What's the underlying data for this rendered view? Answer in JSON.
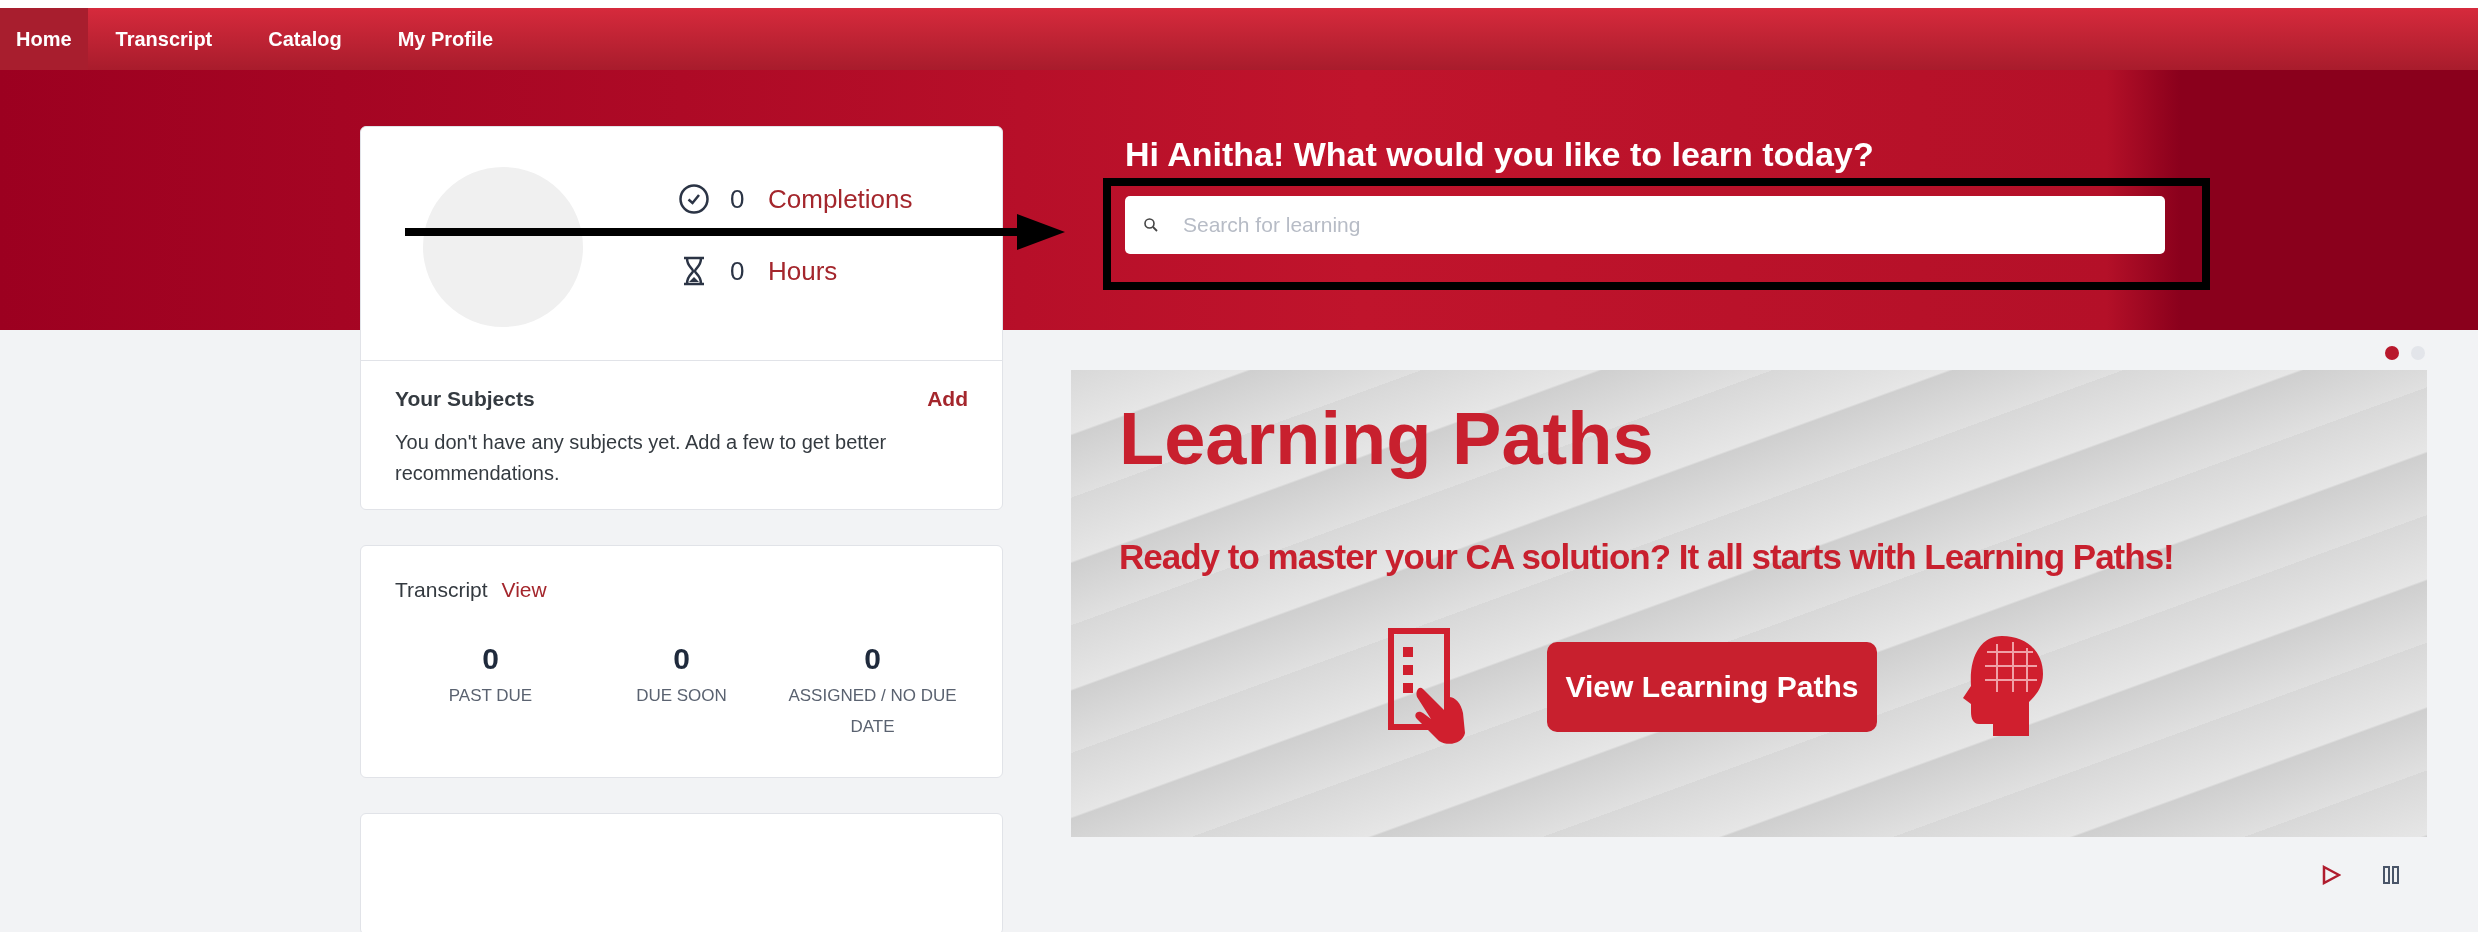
{
  "nav": {
    "tabs": [
      {
        "label": "Home",
        "selected": true
      },
      {
        "label": "Transcript",
        "selected": false
      },
      {
        "label": "Catalog",
        "selected": false
      },
      {
        "label": "My Profile",
        "selected": false
      }
    ]
  },
  "hero": {
    "greeting": "Hi Anitha! What would you like to learn today?",
    "search": {
      "placeholder": "Search for learning"
    }
  },
  "profile": {
    "stats": [
      {
        "kind": "completions",
        "value": "0",
        "label": "Completions"
      },
      {
        "kind": "hours",
        "value": "0",
        "label": "Hours"
      }
    ]
  },
  "subjects": {
    "title": "Your Subjects",
    "action": "Add",
    "message": "You don't have any subjects yet. Add a few to get better recommendations."
  },
  "transcript": {
    "title": "Transcript",
    "action": "View",
    "counts": [
      {
        "value": "0",
        "label": "PAST DUE"
      },
      {
        "value": "0",
        "label": "DUE SOON"
      },
      {
        "value": "0",
        "label": "ASSIGNED / NO DUE DATE"
      }
    ]
  },
  "carousel": {
    "dots": [
      {
        "selected": true
      },
      {
        "selected": false
      }
    ],
    "slide": {
      "title": "Learning Paths",
      "subtitle": "Ready to master your CA solution?  It all starts with Learning Paths!",
      "button": "View Learning Paths"
    }
  }
}
